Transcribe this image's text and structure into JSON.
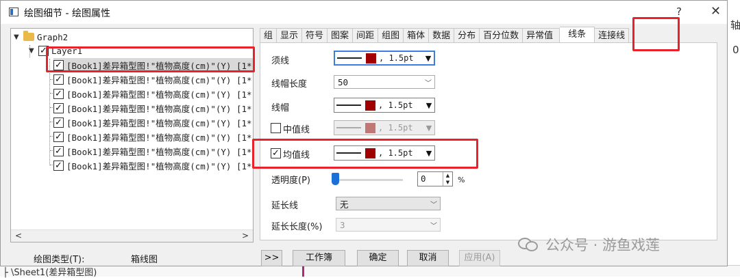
{
  "window": {
    "title": "绘图细节 - 绘图属性",
    "help": "?",
    "close": "✕"
  },
  "background": {
    "right_chars": [
      "轴",
      "0"
    ],
    "bottom_text": "├ \\Sheet1(差异箱型图)"
  },
  "tree": {
    "root_label": "Graph2",
    "layer_label": "Layer1",
    "items": [
      "[Book1]差异箱型图!\"植物高度(cm)\"(Y) [1*",
      "[Book1]差异箱型图!\"植物高度(cm)\"(Y) [1*",
      "[Book1]差异箱型图!\"植物高度(cm)\"(Y) [1*",
      "[Book1]差异箱型图!\"植物高度(cm)\"(Y) [1*",
      "[Book1]差异箱型图!\"植物高度(cm)\"(Y) [1*",
      "[Book1]差异箱型图!\"植物高度(cm)\"(Y) [1*",
      "[Book1]差异箱型图!\"植物高度(cm)\"(Y) [1*",
      "[Book1]差异箱型图!\"植物高度(cm)\"(Y) [1*"
    ],
    "scroll_left": "<",
    "scroll_right": ">"
  },
  "plot_type": {
    "label": "绘图类型(T):",
    "value": "箱线图"
  },
  "tabs": [
    "组",
    "显示",
    "符号",
    "图案",
    "间距",
    "组图",
    "箱体",
    "数据",
    "分布",
    "百分位数",
    "异常值",
    "线条",
    "连接线"
  ],
  "active_tab": "线条",
  "fields": {
    "whisker": {
      "label": "须线",
      "value": ", 1.5pt"
    },
    "cap_length": {
      "label": "线帽长度",
      "value": "50"
    },
    "cap": {
      "label": "线帽",
      "value": ", 1.5pt"
    },
    "median": {
      "label": "中值线",
      "value": ", 1.5pt",
      "checked": false
    },
    "mean": {
      "label": "均值线",
      "value": ", 1.5pt",
      "checked": true
    },
    "transparency": {
      "label": "透明度(P)",
      "value": "0",
      "unit": "%"
    },
    "extension": {
      "label": "延长线",
      "value": "无"
    },
    "extension_length": {
      "label": "延长长度(%)",
      "value": "3"
    }
  },
  "colors": {
    "line_color": "#a00000",
    "highlight": "#e8212b",
    "slider": "#1a6fd8"
  },
  "buttons": {
    "expand": ">>",
    "workbook": "工作簿",
    "ok": "确定",
    "cancel": "取消",
    "apply": "应用(A)"
  },
  "watermark": "公众号 · 游鱼戏莲"
}
